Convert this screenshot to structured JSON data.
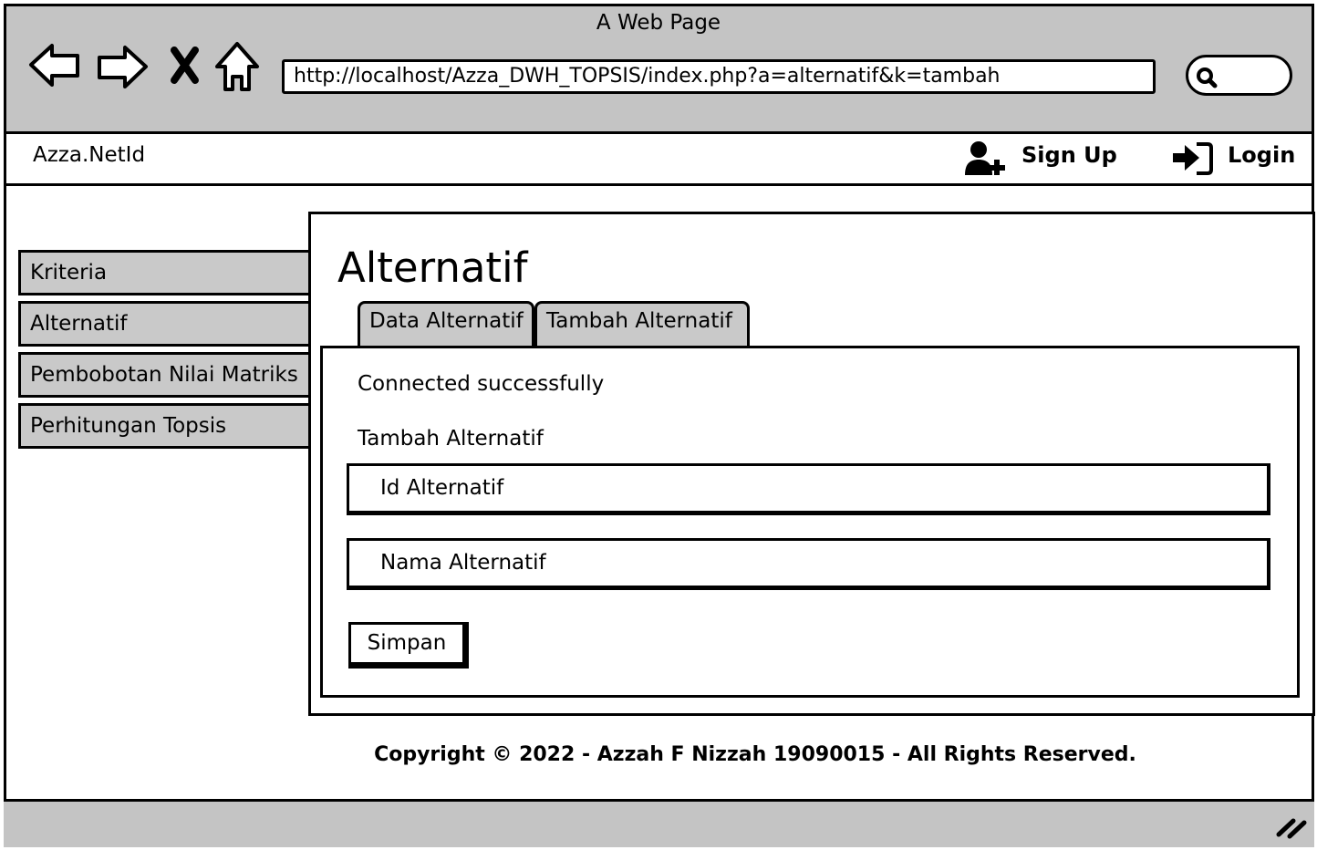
{
  "window": {
    "title": "A Web Page"
  },
  "browser": {
    "url": "http://localhost/Azza_DWH_TOPSIS/index.php?a=alternatif&k=tambah",
    "icons": [
      "back-icon",
      "forward-icon",
      "stop-icon",
      "home-icon",
      "search-icon"
    ]
  },
  "header": {
    "brand": "Azza.NetId",
    "signup_label": "Sign Up",
    "login_label": "Login",
    "icons": [
      "add-user-icon",
      "login-icon"
    ]
  },
  "sidebar": {
    "items": [
      {
        "label": "Kriteria"
      },
      {
        "label": "Alternatif"
      },
      {
        "label": "Pembobotan Nilai Matriks"
      },
      {
        "label": "Perhitungan Topsis"
      }
    ]
  },
  "main": {
    "title": "Alternatif",
    "tabs": [
      {
        "label": "Data Alternatif"
      },
      {
        "label": "Tambah Alternatif"
      }
    ],
    "status_message": "Connected successfully",
    "form": {
      "heading": "Tambah Alternatif",
      "id_placeholder": "Id Alternatif",
      "name_placeholder": "Nama Alternatif",
      "submit_label": "Simpan"
    }
  },
  "footer": {
    "copyright": "Copyright © 2022 - Azzah F Nizzah 19090015 - All Rights Reserved."
  },
  "colors": {
    "chrome": "#c4c4c4",
    "menu_item": "#c9c9c9",
    "border": "#000000",
    "background": "#ffffff"
  }
}
